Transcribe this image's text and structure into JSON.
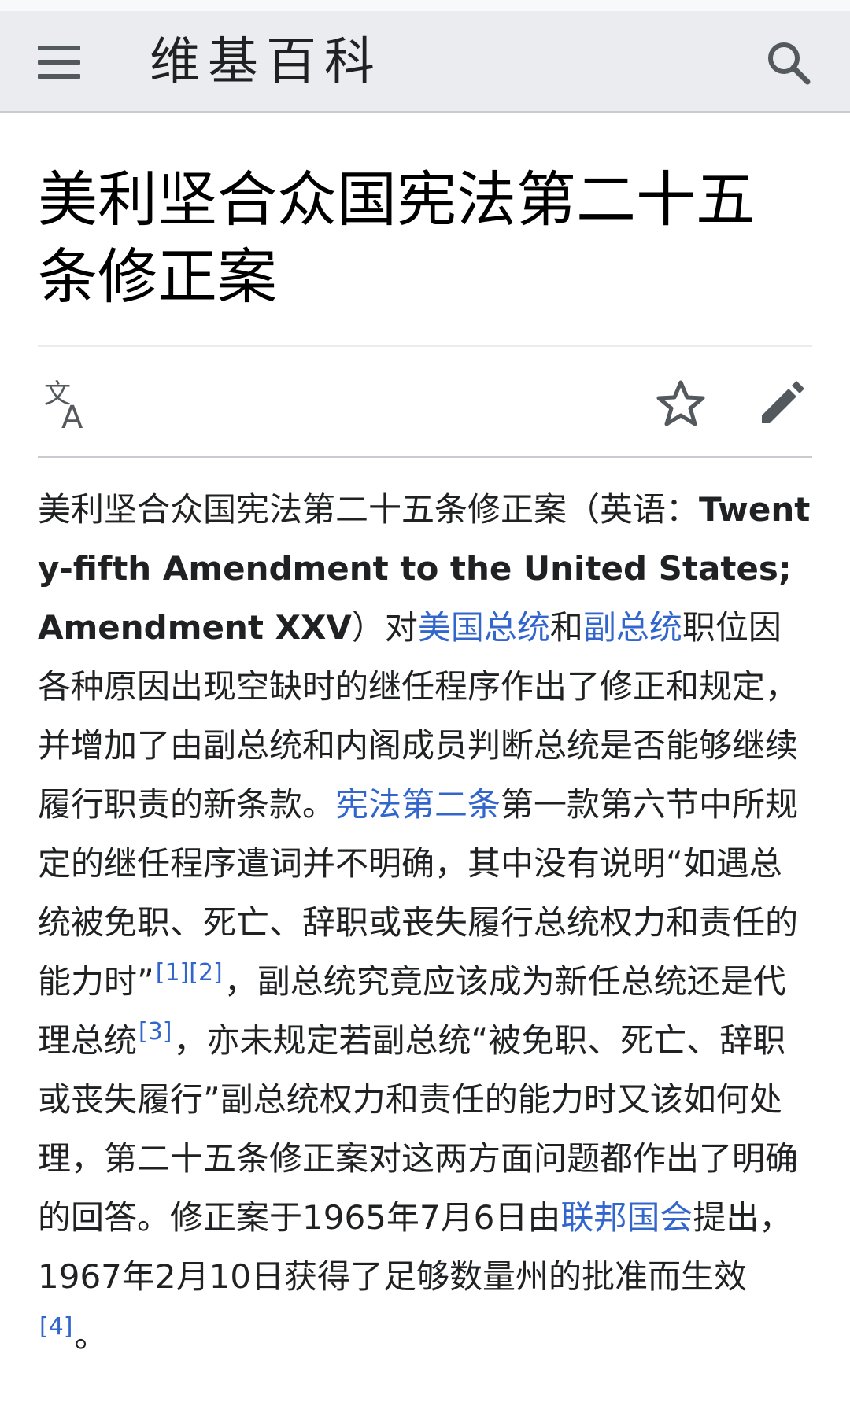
{
  "header": {
    "wordmark": "维基百科",
    "menu_icon": "hamburger-menu-icon",
    "search_icon": "search-icon"
  },
  "article": {
    "title": "美利坚合众国宪法第二十五条修正案",
    "actions": {
      "language_icon": "translate-icon",
      "watch_icon": "star-icon",
      "edit_icon": "pencil-icon"
    },
    "lead": {
      "t1": "美利坚合众国宪法第二十五条修正案（英语：",
      "t2": "Twenty-fifth Amendment to the United States; Amendment XXV",
      "t3": "）对",
      "link_president": "美国总统",
      "t4": "和",
      "link_vp": "副总统",
      "t5": "职位因各种原因出现空缺时的继任程序作出了修正和规定，并增加了由副总统和内阁成员判断总统是否能够继续履行职责的新条款。",
      "link_article2": "宪法第二条",
      "t6": "第一款第六节中所规定的继任程序遣词并不明确，其中没有说明“如遇总统被免职、死亡、辞职或丧失履行总统权力和责任的能力时”",
      "ref1": "[1]",
      "ref2": "[2]",
      "t7": "，副总统究竟应该成为新任总统还是代理总统",
      "ref3": "[3]",
      "t8": "，亦未规定若副总统“被免职、死亡、辞职或丧失履行”副总统权力和责任的能力时又该如何处理，第二十五条修正案对这两方面问题都作出了明确的回答。修正案于1965年7月6日由",
      "link_congress": "联邦国会",
      "t9": "提出，1967年2月10日获得了足够数量州的批准而生效",
      "ref4": "[4]",
      "t10": "。"
    }
  },
  "colors": {
    "link": "#3366cc",
    "header_bg": "#eaecf0",
    "text": "#202122",
    "icon": "#54595d"
  }
}
